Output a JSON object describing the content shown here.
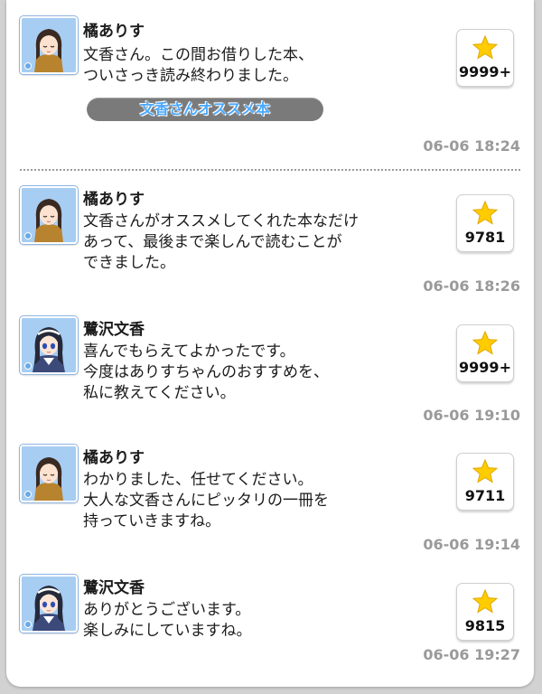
{
  "posts": [
    {
      "name": "橘ありす",
      "avatar": "arisu",
      "lines": [
        "文香さん。この間お借りした本、",
        "ついさっき読み終わりました。"
      ],
      "tag": "文香さんオススメ本",
      "likes": "9999+",
      "time": "06-06 18:24"
    },
    {
      "name": "橘ありす",
      "avatar": "arisu",
      "lines": [
        "文香さんがオススメしてくれた本なだけ",
        "あって、最後まで楽しんで読むことが",
        "できました。"
      ],
      "likes": "9781",
      "time": "06-06 18:26"
    },
    {
      "name": "鷺沢文香",
      "avatar": "fumika",
      "lines": [
        "喜んでもらえてよかったです。",
        "今度はありすちゃんのおすすめを、",
        "私に教えてください。"
      ],
      "likes": "9999+",
      "time": "06-06 19:10"
    },
    {
      "name": "橘ありす",
      "avatar": "arisu",
      "lines": [
        "わかりました、任せてください。",
        "大人な文香さんにピッタリの一冊を",
        "持っていきますね。"
      ],
      "likes": "9711",
      "time": "06-06 19:14"
    },
    {
      "name": "鷺沢文香",
      "avatar": "fumika",
      "lines": [
        "ありがとうございます。",
        "楽しみにしていますね。"
      ],
      "likes": "9815",
      "time": "06-06 19:27"
    }
  ],
  "colors": {
    "star": "#ffcc00",
    "timestamp": "#9a9a9a",
    "tag_text": "#4aa8ff",
    "avatar_bg": "#a7cdf2"
  },
  "icons": {
    "like": "star-icon",
    "avatar_arisu": "arisu-avatar-icon",
    "avatar_fumika": "fumika-avatar-icon"
  }
}
